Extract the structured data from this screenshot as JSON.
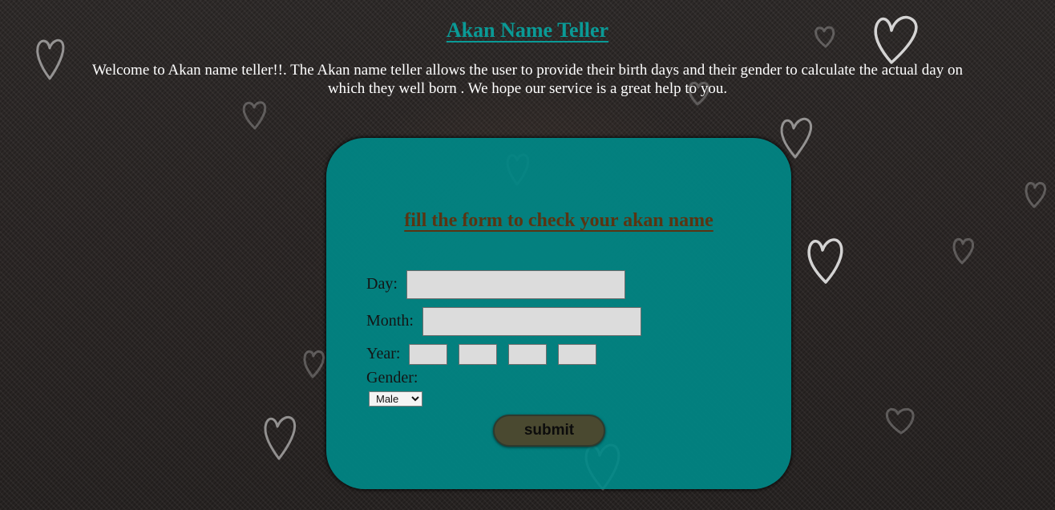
{
  "header": {
    "title": "Akan Name Teller",
    "intro": "Welcome to Akan name teller!!. The Akan name teller allows the user to provide their birth days and their gender to calculate the actual day on which they well born . We hope our service is a great help to you."
  },
  "form": {
    "heading": "fill the form to check your akan name",
    "day_label": "Day:",
    "day_value": "",
    "month_label": "Month:",
    "month_value": "",
    "year_label": "Year:",
    "year_digits": [
      "",
      "",
      "",
      ""
    ],
    "gender_label": "Gender:",
    "gender_selected": "Male",
    "submit_label": "submit"
  },
  "colors": {
    "title": "#0a9a96",
    "card": "#008785",
    "heading": "#5a3412",
    "button": "#4a4930"
  }
}
